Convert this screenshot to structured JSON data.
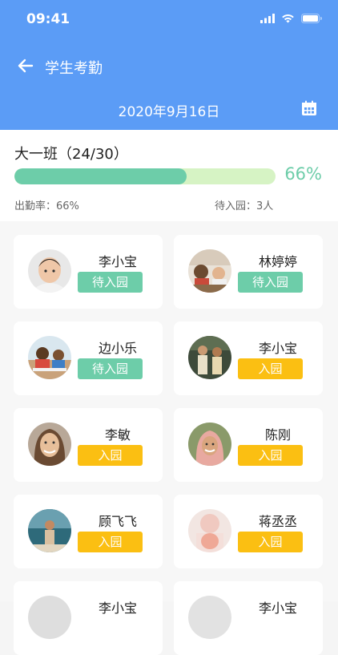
{
  "status_bar": {
    "time": "09:41"
  },
  "header": {
    "title": "学生考勤",
    "date": "2020年9月16日"
  },
  "summary": {
    "class_name": "大一班（24/30）",
    "progress_fraction": 0.66,
    "progress_text": "66%",
    "attendance_rate": "出勤率：66%",
    "pending_count": "待入园：3人"
  },
  "colors": {
    "header_bg": "#5b9cf6",
    "progress": "#6dcda9",
    "pending_button": "#6dcda9",
    "entered_button": "#fbbf12"
  },
  "students": [
    {
      "name": "李小宝",
      "status": "待入园",
      "status_type": "pending"
    },
    {
      "name": "林婷婷",
      "status": "待入园",
      "status_type": "pending"
    },
    {
      "name": "边小乐",
      "status": "待入园",
      "status_type": "pending"
    },
    {
      "name": "李小宝",
      "status": "入园",
      "status_type": "entered"
    },
    {
      "name": "李敏",
      "status": "入园",
      "status_type": "entered"
    },
    {
      "name": "陈刚",
      "status": "入园",
      "status_type": "entered"
    },
    {
      "name": "顾飞飞",
      "status": "入园",
      "status_type": "entered"
    },
    {
      "name": "蒋丞丞",
      "status": "入园",
      "status_type": "entered"
    },
    {
      "name": "李小宝",
      "status": "",
      "status_type": "entered"
    },
    {
      "name": "李小宝",
      "status": "",
      "status_type": "entered"
    }
  ]
}
